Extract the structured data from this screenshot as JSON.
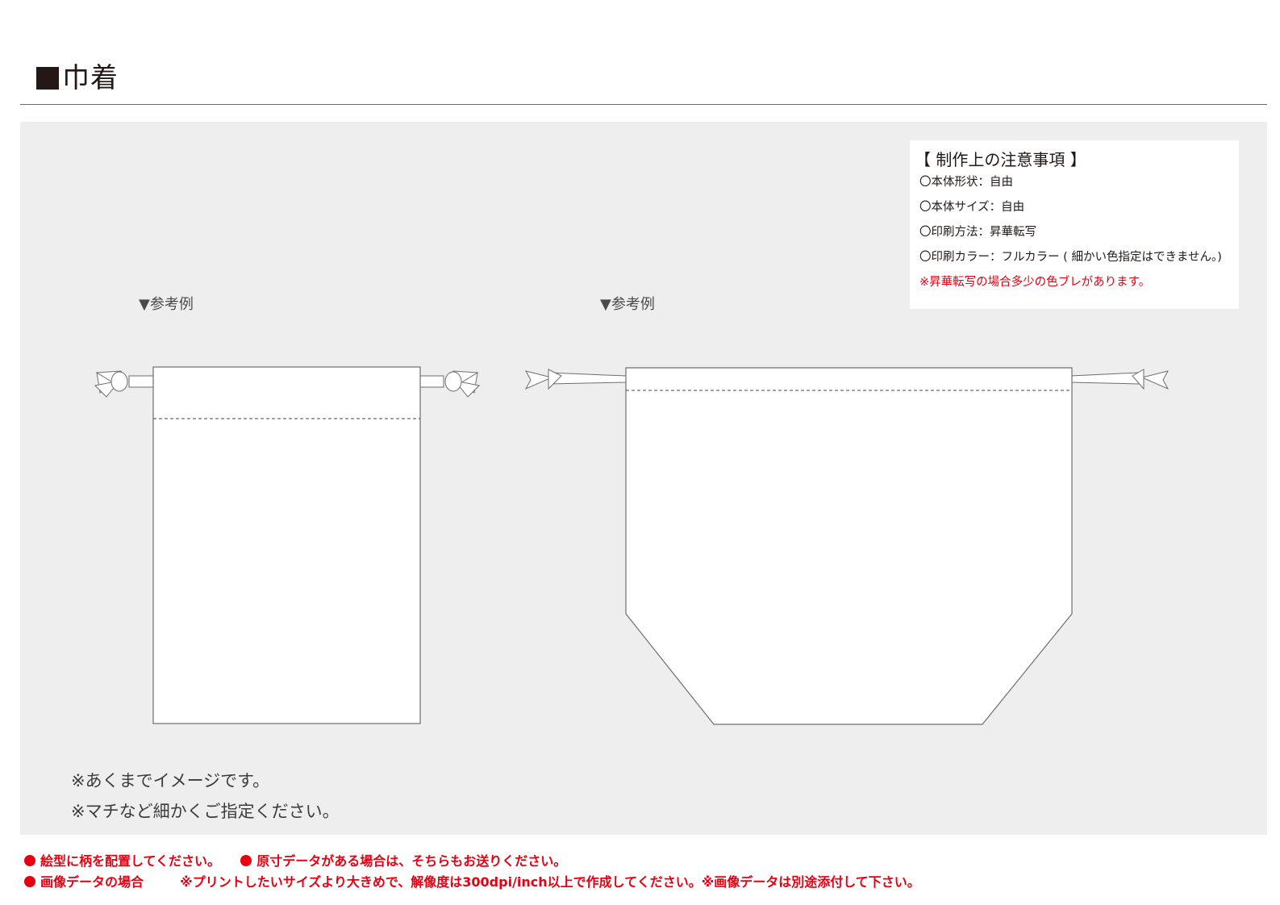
{
  "header": {
    "title": "巾着"
  },
  "notes": {
    "heading": "【 制作上の注意事項 】",
    "items": [
      "〇本体形状：自由",
      "〇本体サイズ：自由",
      "〇印刷方法：昇華転写",
      "〇印刷カラー：フルカラー ( 細かい色指定はできません。)"
    ],
    "warning": "※昇華転写の場合多少の色ブレがあります。"
  },
  "examples": {
    "left_label": "▼参考例",
    "right_label": "▼参考例"
  },
  "remarks": [
    "※あくまでイメージです。",
    "※マチなど細かくご指定ください。"
  ],
  "footer": {
    "line1_a": "絵型に柄を配置してください。",
    "line1_b": "原寸データがある場合は、そちらもお送りください。",
    "line2_a": "画像データの場合",
    "line2_b": "※プリントしたいサイズより大きめで、解像度は300dpi/inch以上で作成してください。※画像データは別途添付して下さい。"
  },
  "colors": {
    "accent_red": "#e60012",
    "panel_gray": "#edeeed",
    "text_dark": "#231815"
  }
}
